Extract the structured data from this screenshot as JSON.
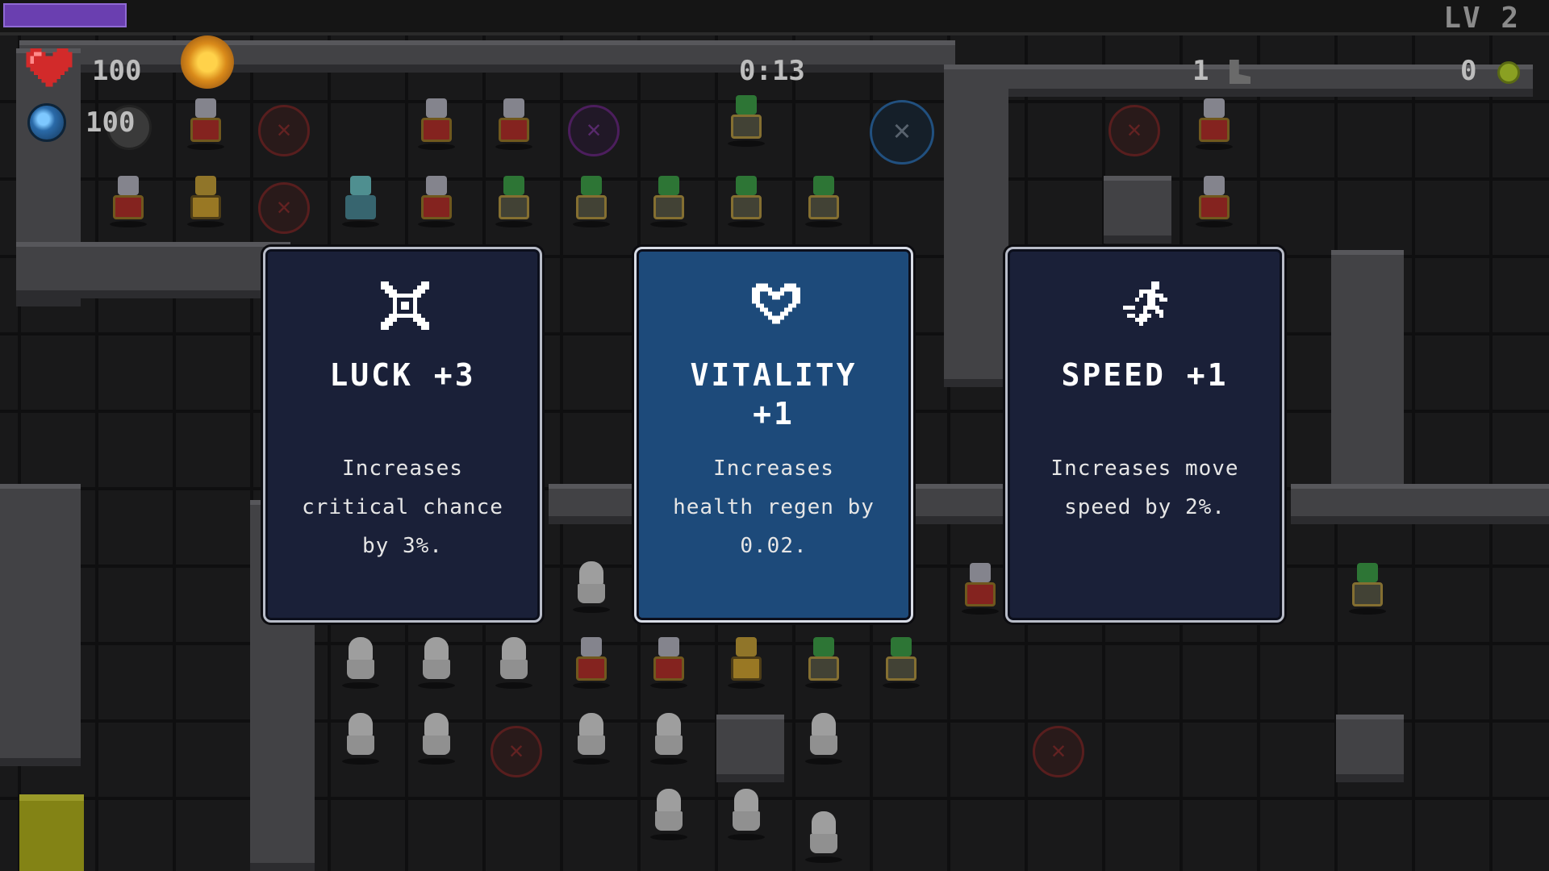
{
  "hud": {
    "health": "100",
    "mana": "100",
    "timer": "0:13",
    "level": "LV 2",
    "xp_progress": 0.08,
    "kills": "1",
    "gold": "0",
    "icons": [
      "heart-icon",
      "mana-orb-icon",
      "torch-icon",
      "bomb-icon",
      "boot-icon",
      "coin-icon"
    ]
  },
  "upgrades": [
    {
      "icon": "crossed-swords-icon",
      "title": "LUCK +3",
      "description": [
        "Increases",
        "critical chance",
        "by 3%."
      ],
      "selected": false
    },
    {
      "icon": "heart-icon",
      "title_line1": "VITALITY",
      "title_line2": "+1",
      "description": [
        "Increases",
        "health regen by",
        "0.02."
      ],
      "selected": true
    },
    {
      "icon": "running-man-icon",
      "title": "SPEED +1",
      "description": [
        "Increases move",
        "speed by 2%."
      ],
      "selected": false
    }
  ],
  "colors": {
    "card_bg": "#1a2038",
    "card_selected_bg": "#1d4a7a",
    "card_border": "#b8bcc8",
    "xp_fill": "#6a3fb0",
    "health_red": "#d22a2a"
  }
}
